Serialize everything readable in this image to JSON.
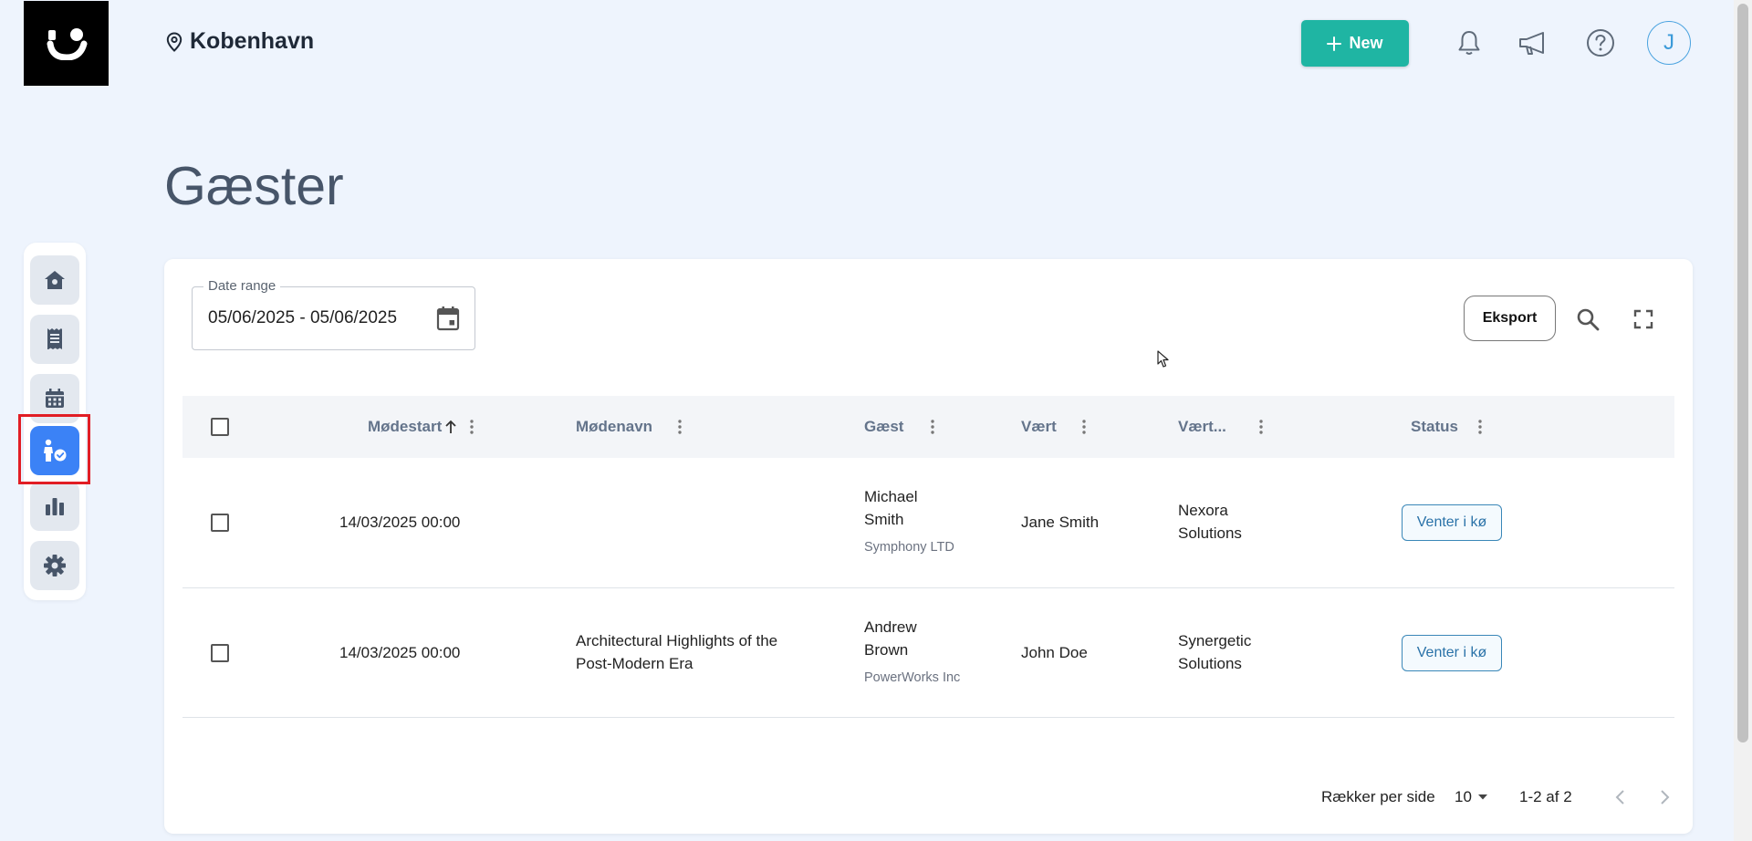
{
  "header": {
    "location": "Kobenhavn",
    "new_label": "New",
    "avatar_initial": "J"
  },
  "sidebar": {
    "items": [
      {
        "name": "home",
        "icon": "home-icon",
        "active": false
      },
      {
        "name": "receipts",
        "icon": "receipt-icon",
        "active": false
      },
      {
        "name": "calendar",
        "icon": "calendar-icon",
        "active": false
      },
      {
        "name": "guests",
        "icon": "guest-check-icon",
        "active": true
      },
      {
        "name": "statistics",
        "icon": "bar-chart-icon",
        "active": false
      },
      {
        "name": "settings",
        "icon": "gear-icon",
        "active": false
      }
    ]
  },
  "page": {
    "title": "Gæster"
  },
  "toolbar": {
    "date_range_label": "Date range",
    "date_range_value": "05/06/2025 - 05/06/2025",
    "export_label": "Eksport"
  },
  "table": {
    "columns": [
      "Mødestart",
      "Mødenavn",
      "Gæst",
      "Vært",
      "Vært...",
      "Status"
    ],
    "sort_column": "Mødestart",
    "rows": [
      {
        "start": "14/03/2025 00:00",
        "meeting": "",
        "guest_line1": "Michael",
        "guest_line2": "Smith",
        "guest_company": "Symphony LTD",
        "host": "Jane Smith",
        "host_company_line1": "Nexora",
        "host_company_line2": "Solutions",
        "status": "Venter i kø"
      },
      {
        "start": "14/03/2025 00:00",
        "meeting_line1": "Architectural Highlights of the",
        "meeting_line2": "Post-Modern Era",
        "guest_line1": "Andrew",
        "guest_line2": "Brown",
        "guest_company": "PowerWorks Inc",
        "host": "John Doe",
        "host_company_line1": "Synergetic",
        "host_company_line2": "Solutions",
        "status": "Venter i kø"
      }
    ]
  },
  "pagination": {
    "rows_per_page_label": "Rækker per side",
    "rows_per_page": "10",
    "range": "1-2 af 2"
  },
  "colors": {
    "accent_green": "#1fb5a3",
    "active_blue": "#3b82f6",
    "highlight_red": "#e11d24",
    "background": "#eef4fd"
  }
}
